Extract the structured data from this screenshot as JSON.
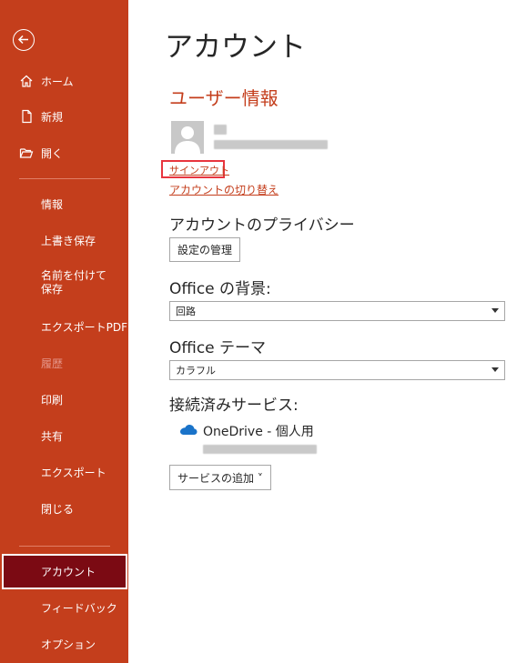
{
  "sidebar": {
    "items": [
      {
        "label": "ホーム",
        "icon": "home-icon"
      },
      {
        "label": "新規",
        "icon": "new-document-icon"
      },
      {
        "label": "開く",
        "icon": "open-folder-icon"
      },
      {
        "label": "情報"
      },
      {
        "label": "上書き保存"
      },
      {
        "label": "名前を付けて保存"
      },
      {
        "label": "エクスポートPDF"
      },
      {
        "label": "履歴",
        "disabled": true
      },
      {
        "label": "印刷"
      },
      {
        "label": "共有"
      },
      {
        "label": "エクスポート"
      },
      {
        "label": "閉じる"
      },
      {
        "label": "アカウント",
        "active": true
      },
      {
        "label": "フィードバック"
      },
      {
        "label": "オプション"
      }
    ],
    "back_icon": "back-arrow-icon"
  },
  "main": {
    "title": "アカウント",
    "user_info": {
      "heading": "ユーザー情報",
      "sign_out": "サインアウト",
      "switch_account": "アカウントの切り替え"
    },
    "privacy": {
      "heading": "アカウントのプライバシー",
      "manage_button": "設定の管理"
    },
    "background": {
      "heading": "Office の背景:",
      "selected": "回路"
    },
    "theme": {
      "heading": "Office テーマ",
      "selected": "カラフル"
    },
    "services": {
      "heading": "接続済みサービス:",
      "onedrive": "OneDrive - 個人用",
      "add_button": "サービスの追加 ˅"
    }
  },
  "colors": {
    "sidebar": "#c43e1c",
    "active_item": "#7b0a13",
    "accent": "#c43e1c",
    "highlight_box": "#e8353e"
  }
}
